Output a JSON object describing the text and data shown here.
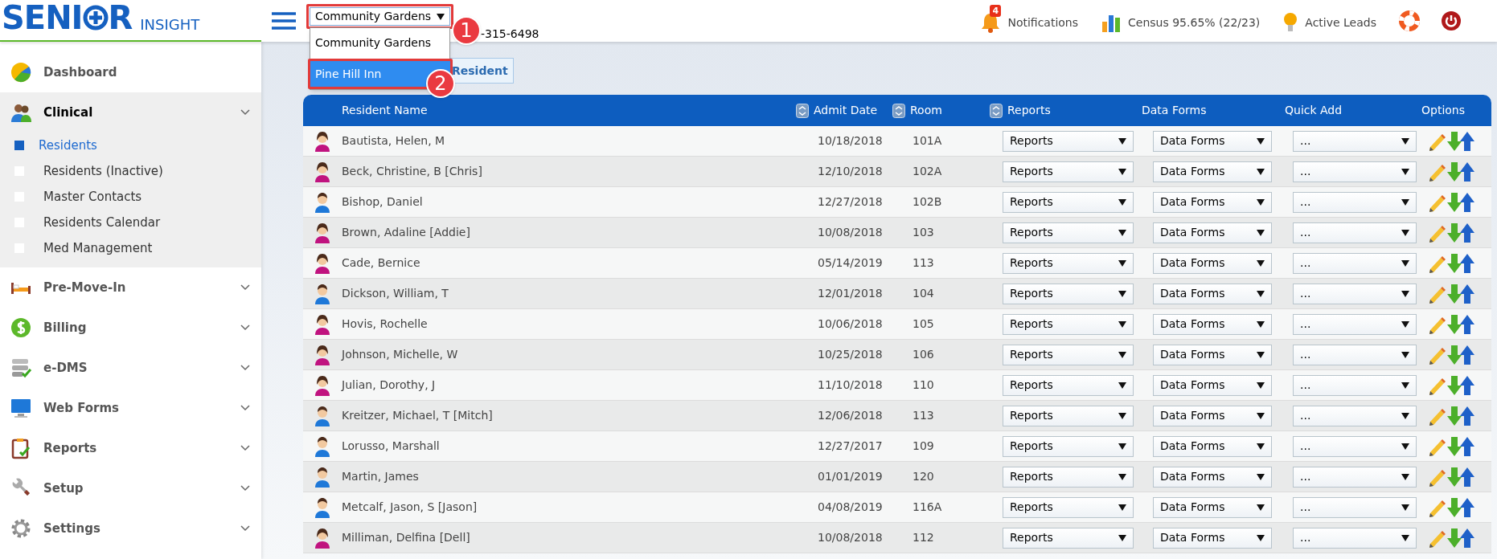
{
  "logo": {
    "brand_start": "SENI",
    "brand_end": "R",
    "product": "INSIGHT"
  },
  "facility_select": {
    "value": "Community Gardens",
    "options": [
      {
        "label": "Community Gardens",
        "highlighted": false
      },
      {
        "label": "Pine Hill Inn",
        "highlighted": true
      }
    ]
  },
  "phone": "-315-6498",
  "annotations": [
    {
      "label": "1"
    },
    {
      "label": "2"
    }
  ],
  "top_nav": [
    {
      "kind": "notifications",
      "label": "Notifications",
      "badge": "4"
    },
    {
      "kind": "census",
      "label": "Census 95.65% (22/23)"
    },
    {
      "kind": "leads",
      "label": "Active Leads"
    },
    {
      "kind": "help"
    },
    {
      "kind": "power"
    }
  ],
  "sidebar": {
    "items": [
      {
        "kind": "dashboard",
        "label": "Dashboard"
      },
      {
        "kind": "clinical",
        "label": "Clinical",
        "expanded": true,
        "children": [
          {
            "label": "Residents",
            "selected": true
          },
          {
            "label": "Residents (Inactive)",
            "selected": false
          },
          {
            "label": "Master Contacts",
            "selected": false
          },
          {
            "label": "Residents Calendar",
            "selected": false
          },
          {
            "label": "Med Management",
            "selected": false
          }
        ]
      },
      {
        "kind": "bed",
        "label": "Pre-Move-In",
        "expanded": false
      },
      {
        "kind": "billing",
        "label": "Billing",
        "expanded": false
      },
      {
        "kind": "edms",
        "label": "e-DMS",
        "expanded": false
      },
      {
        "kind": "monitor",
        "label": "Web Forms",
        "expanded": false
      },
      {
        "kind": "clipboard",
        "label": "Reports",
        "expanded": false
      },
      {
        "kind": "wrench",
        "label": "Setup",
        "expanded": false
      },
      {
        "kind": "gear",
        "label": "Settings",
        "expanded": false
      }
    ]
  },
  "toolbar": {
    "button": "Resident"
  },
  "table": {
    "columns": [
      {
        "label": "Resident Name",
        "sortable": false
      },
      {
        "label": "Admit Date",
        "sortable": true
      },
      {
        "label": "Room",
        "sortable": true
      },
      {
        "label": "Reports",
        "sortable": true
      },
      {
        "label": "Data Forms",
        "sortable": false
      },
      {
        "label": "Quick Add",
        "sortable": false
      },
      {
        "label": "Options",
        "sortable": false
      }
    ],
    "rows": [
      {
        "kind": "female",
        "name": "Bautista, Helen, M",
        "admit_date": "10/18/2018",
        "room": "101A",
        "reports": "Reports",
        "data_forms": "Data Forms",
        "quick_add": "..."
      },
      {
        "kind": "female",
        "name": "Beck, Christine, B [Chris]",
        "admit_date": "12/10/2018",
        "room": "102A",
        "reports": "Reports",
        "data_forms": "Data Forms",
        "quick_add": "..."
      },
      {
        "kind": "male",
        "name": "Bishop, Daniel",
        "admit_date": "12/27/2018",
        "room": "102B",
        "reports": "Reports",
        "data_forms": "Data Forms",
        "quick_add": "..."
      },
      {
        "kind": "female",
        "name": "Brown, Adaline [Addie]",
        "admit_date": "10/08/2018",
        "room": "103",
        "reports": "Reports",
        "data_forms": "Data Forms",
        "quick_add": "..."
      },
      {
        "kind": "female",
        "name": "Cade, Bernice",
        "admit_date": "05/14/2019",
        "room": "113",
        "reports": "Reports",
        "data_forms": "Data Forms",
        "quick_add": "..."
      },
      {
        "kind": "male",
        "name": "Dickson, William, T",
        "admit_date": "12/01/2018",
        "room": "104",
        "reports": "Reports",
        "data_forms": "Data Forms",
        "quick_add": "..."
      },
      {
        "kind": "female",
        "name": "Hovis, Rochelle",
        "admit_date": "10/06/2018",
        "room": "105",
        "reports": "Reports",
        "data_forms": "Data Forms",
        "quick_add": "..."
      },
      {
        "kind": "female",
        "name": "Johnson, Michelle, W",
        "admit_date": "10/25/2018",
        "room": "106",
        "reports": "Reports",
        "data_forms": "Data Forms",
        "quick_add": "..."
      },
      {
        "kind": "female",
        "name": "Julian, Dorothy, J",
        "admit_date": "11/10/2018",
        "room": "110",
        "reports": "Reports",
        "data_forms": "Data Forms",
        "quick_add": "..."
      },
      {
        "kind": "male",
        "name": "Kreitzer, Michael, T [Mitch]",
        "admit_date": "12/06/2018",
        "room": "113",
        "reports": "Reports",
        "data_forms": "Data Forms",
        "quick_add": "..."
      },
      {
        "kind": "male",
        "name": "Lorusso, Marshall",
        "admit_date": "12/27/2017",
        "room": "109",
        "reports": "Reports",
        "data_forms": "Data Forms",
        "quick_add": "..."
      },
      {
        "kind": "male",
        "name": "Martin, James",
        "admit_date": "01/01/2019",
        "room": "120",
        "reports": "Reports",
        "data_forms": "Data Forms",
        "quick_add": "..."
      },
      {
        "kind": "male",
        "name": "Metcalf, Jason, S [Jason]",
        "admit_date": "04/08/2019",
        "room": "116A",
        "reports": "Reports",
        "data_forms": "Data Forms",
        "quick_add": "..."
      },
      {
        "kind": "female",
        "name": "Milliman, Delfina [Dell]",
        "admit_date": "10/08/2018",
        "room": "112",
        "reports": "Reports",
        "data_forms": "Data Forms",
        "quick_add": "..."
      }
    ]
  }
}
